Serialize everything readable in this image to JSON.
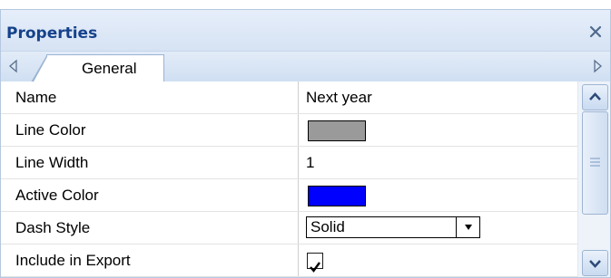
{
  "panel": {
    "title": "Properties",
    "close_icon": "close-icon",
    "tabs": [
      {
        "label": "General",
        "active": true
      }
    ],
    "tab_scroll_left_icon": "triangle-left-icon",
    "tab_scroll_right_icon": "triangle-right-icon"
  },
  "properties": [
    {
      "name": "Name",
      "value": "Next year",
      "type": "text"
    },
    {
      "name": "Line Color",
      "value": "#9a9a9a",
      "type": "color"
    },
    {
      "name": "Line Width",
      "value": "1",
      "type": "text"
    },
    {
      "name": "Active Color",
      "value": "#0000ff",
      "type": "color"
    },
    {
      "name": "Dash Style",
      "value": "Solid",
      "type": "dropdown"
    },
    {
      "name": "Include in Export",
      "value": true,
      "type": "checkbox"
    }
  ],
  "scrollbar": {
    "up_icon": "chevron-up-icon",
    "down_icon": "chevron-down-icon"
  },
  "colors": {
    "title_text": "#15428b",
    "header_bg": "#d6e3f4",
    "border": "#b5c8df"
  }
}
